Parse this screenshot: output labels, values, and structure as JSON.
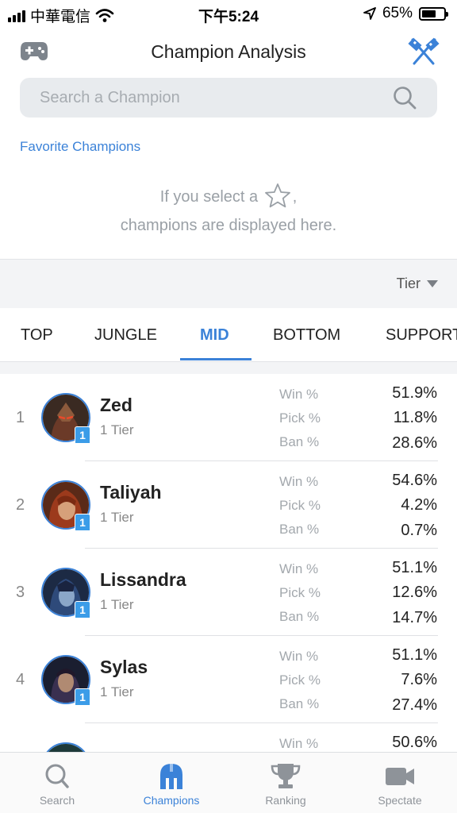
{
  "status_bar": {
    "carrier": "中華電信",
    "time": "下午5:24",
    "battery_percent": "65%",
    "battery_level": 0.65
  },
  "header": {
    "title": "Champion Analysis",
    "left_icon": "gamepad-icon",
    "right_icon": "crossed-flags-icon"
  },
  "search": {
    "placeholder": "Search a Champion",
    "value": ""
  },
  "favorites": {
    "label": "Favorite Champions",
    "empty_line1_before": "If you select a",
    "empty_line1_after": ",",
    "empty_line2": "champions are displayed here."
  },
  "sort": {
    "selected": "Tier"
  },
  "tabs": [
    {
      "label": "TOP"
    },
    {
      "label": "JUNGLE"
    },
    {
      "label": "MID"
    },
    {
      "label": "BOTTOM"
    },
    {
      "label": "SUPPORT"
    }
  ],
  "active_tab": "MID",
  "stat_labels": {
    "win": "Win %",
    "pick": "Pick %",
    "ban": "Ban %"
  },
  "champions": [
    {
      "rank": "1",
      "name": "Zed",
      "tier": "1 Tier",
      "badge": "1",
      "win": "51.9%",
      "pick": "11.8%",
      "ban": "28.6%"
    },
    {
      "rank": "2",
      "name": "Taliyah",
      "tier": "1 Tier",
      "badge": "1",
      "win": "54.6%",
      "pick": "4.2%",
      "ban": "0.7%"
    },
    {
      "rank": "3",
      "name": "Lissandra",
      "tier": "1 Tier",
      "badge": "1",
      "win": "51.1%",
      "pick": "12.6%",
      "ban": "14.7%"
    },
    {
      "rank": "4",
      "name": "Sylas",
      "tier": "1 Tier",
      "badge": "1",
      "win": "51.1%",
      "pick": "7.6%",
      "ban": "27.4%"
    },
    {
      "rank": "",
      "name": "",
      "tier": "",
      "badge": "",
      "win": "50.6%",
      "pick": "",
      "ban": ""
    }
  ],
  "bottom_nav": [
    {
      "label": "Search",
      "icon": "search-icon"
    },
    {
      "label": "Champions",
      "icon": "helmet-icon"
    },
    {
      "label": "Ranking",
      "icon": "trophy-icon"
    },
    {
      "label": "Spectate",
      "icon": "video-camera-icon"
    }
  ],
  "active_nav": "Champions",
  "colors": {
    "accent": "#3b82d8",
    "badge": "#3b9ce8"
  }
}
